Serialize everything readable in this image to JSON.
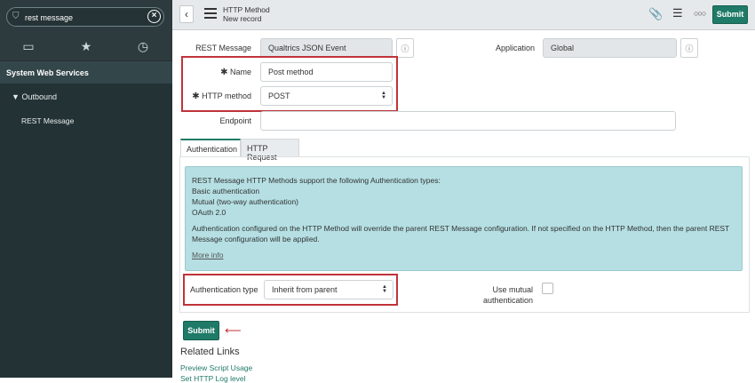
{
  "sidebar": {
    "search_value": "rest message",
    "tabs": [
      {
        "icon": "archive-icon"
      },
      {
        "icon": "star-icon"
      },
      {
        "icon": "clock-icon"
      }
    ],
    "section": "System Web Services",
    "group": "Outbound",
    "item": "REST Message"
  },
  "header": {
    "title": "HTTP Method",
    "subtitle": "New record",
    "submit": "Submit"
  },
  "form": {
    "rest_message_label": "REST Message",
    "rest_message_value": "Qualtrics JSON Event",
    "application_label": "Application",
    "application_value": "Global",
    "name_label": "Name",
    "name_value": "Post method",
    "http_method_label": "HTTP method",
    "http_method_value": "POST",
    "endpoint_label": "Endpoint",
    "endpoint_value": "",
    "required_mark": "✱"
  },
  "tabs": [
    "Authentication",
    "HTTP Request"
  ],
  "info": {
    "lines": [
      "REST Message HTTP Methods support the following Authentication types:",
      "Basic authentication",
      "Mutual (two-way authentication)",
      "OAuth 2.0"
    ],
    "paragraph": "Authentication configured on the HTTP Method will override the parent REST Message configuration. If not specified on the HTTP Method, then the parent REST Message configuration will be applied.",
    "more": "More info"
  },
  "auth": {
    "type_label": "Authentication type",
    "type_value": "Inherit from parent",
    "mutual_label": "Use mutual authentication",
    "mutual_checked": false
  },
  "submit": "Submit",
  "related": {
    "title": "Related Links",
    "links": [
      "Preview Script Usage",
      "Set HTTP Log level"
    ]
  },
  "colors": {
    "accent": "#1f7a67",
    "highlight": "#c0333a",
    "info_bg": "#b5dfe3",
    "sidebar": "#2d3b3e"
  }
}
